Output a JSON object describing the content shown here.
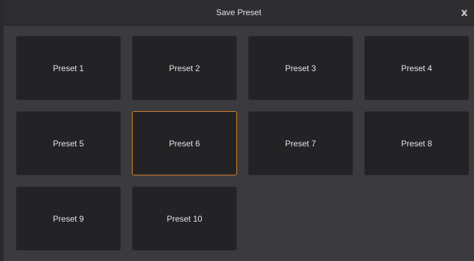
{
  "dialog": {
    "title": "Save Preset",
    "close_label": "x"
  },
  "presets": [
    {
      "label": "Preset 1",
      "selected": false
    },
    {
      "label": "Preset 2",
      "selected": false
    },
    {
      "label": "Preset 3",
      "selected": false
    },
    {
      "label": "Preset 4",
      "selected": false
    },
    {
      "label": "Preset 5",
      "selected": false
    },
    {
      "label": "Preset 6",
      "selected": true
    },
    {
      "label": "Preset 7",
      "selected": false
    },
    {
      "label": "Preset 8",
      "selected": false
    },
    {
      "label": "Preset 9",
      "selected": false
    },
    {
      "label": "Preset 10",
      "selected": false
    }
  ],
  "colors": {
    "background": "#3b3b3f",
    "tile": "#232326",
    "selected_border": "#d9822b",
    "text": "#e6e6e8"
  }
}
